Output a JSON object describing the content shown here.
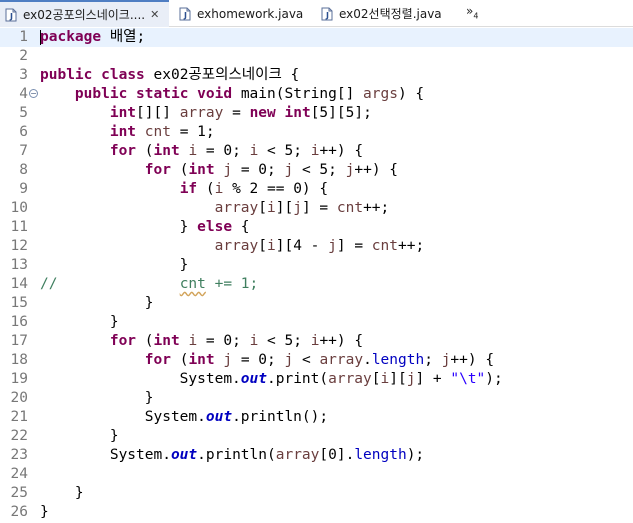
{
  "tabs": [
    {
      "label": "ex02공포의스네이크....",
      "active": true,
      "closable": true,
      "icon": "java-file-icon"
    },
    {
      "label": "exhomework.java",
      "active": false,
      "closable": false,
      "icon": "java-file-icon"
    },
    {
      "label": "ex02선택정렬.java",
      "active": false,
      "closable": false,
      "icon": "java-file-icon"
    }
  ],
  "overflow": {
    "glyph": "»",
    "count": "4"
  },
  "editor": {
    "current_line": 1,
    "lines": [
      {
        "n": "1",
        "tokens": [
          [
            "kw",
            "package"
          ],
          [
            "t",
            " 배열;"
          ]
        ]
      },
      {
        "n": "2",
        "tokens": []
      },
      {
        "n": "3",
        "tokens": [
          [
            "kw",
            "public"
          ],
          [
            "t",
            " "
          ],
          [
            "kw",
            "class"
          ],
          [
            "t",
            " ex02공포의스네이크 {"
          ]
        ]
      },
      {
        "n": "4",
        "fold": "⊖",
        "tokens": [
          [
            "t",
            "    "
          ],
          [
            "kw",
            "public"
          ],
          [
            "t",
            " "
          ],
          [
            "kw",
            "static"
          ],
          [
            "t",
            " "
          ],
          [
            "kw",
            "void"
          ],
          [
            "t",
            " main(String[] "
          ],
          [
            "var",
            "args"
          ],
          [
            "t",
            ") {"
          ]
        ]
      },
      {
        "n": "5",
        "tokens": [
          [
            "t",
            "        "
          ],
          [
            "kw",
            "int"
          ],
          [
            "t",
            "[][] "
          ],
          [
            "var",
            "array"
          ],
          [
            "t",
            " = "
          ],
          [
            "kw",
            "new"
          ],
          [
            "t",
            " "
          ],
          [
            "kw",
            "int"
          ],
          [
            "t",
            "[5][5];"
          ]
        ]
      },
      {
        "n": "6",
        "tokens": [
          [
            "t",
            "        "
          ],
          [
            "kw",
            "int"
          ],
          [
            "t",
            " "
          ],
          [
            "var",
            "cnt"
          ],
          [
            "t",
            " = 1;"
          ]
        ]
      },
      {
        "n": "7",
        "tokens": [
          [
            "t",
            "        "
          ],
          [
            "kw",
            "for"
          ],
          [
            "t",
            " ("
          ],
          [
            "kw",
            "int"
          ],
          [
            "t",
            " "
          ],
          [
            "var",
            "i"
          ],
          [
            "t",
            " = 0; "
          ],
          [
            "var",
            "i"
          ],
          [
            "t",
            " < 5; "
          ],
          [
            "var",
            "i"
          ],
          [
            "t",
            "++) {"
          ]
        ]
      },
      {
        "n": "8",
        "tokens": [
          [
            "t",
            "            "
          ],
          [
            "kw",
            "for"
          ],
          [
            "t",
            " ("
          ],
          [
            "kw",
            "int"
          ],
          [
            "t",
            " "
          ],
          [
            "var",
            "j"
          ],
          [
            "t",
            " = 0; "
          ],
          [
            "var",
            "j"
          ],
          [
            "t",
            " < 5; "
          ],
          [
            "var",
            "j"
          ],
          [
            "t",
            "++) {"
          ]
        ]
      },
      {
        "n": "9",
        "tokens": [
          [
            "t",
            "                "
          ],
          [
            "kw",
            "if"
          ],
          [
            "t",
            " ("
          ],
          [
            "var",
            "i"
          ],
          [
            "t",
            " % 2 == 0) {"
          ]
        ]
      },
      {
        "n": "10",
        "tokens": [
          [
            "t",
            "                    "
          ],
          [
            "var",
            "array"
          ],
          [
            "t",
            "["
          ],
          [
            "var",
            "i"
          ],
          [
            "t",
            "]["
          ],
          [
            "var",
            "j"
          ],
          [
            "t",
            "] = "
          ],
          [
            "var",
            "cnt"
          ],
          [
            "t",
            "++;"
          ]
        ]
      },
      {
        "n": "11",
        "tokens": [
          [
            "t",
            "                } "
          ],
          [
            "kw",
            "else"
          ],
          [
            "t",
            " {"
          ]
        ]
      },
      {
        "n": "12",
        "tokens": [
          [
            "t",
            "                    "
          ],
          [
            "var",
            "array"
          ],
          [
            "t",
            "["
          ],
          [
            "var",
            "i"
          ],
          [
            "t",
            "][4 - "
          ],
          [
            "var",
            "j"
          ],
          [
            "t",
            "] = "
          ],
          [
            "var",
            "cnt"
          ],
          [
            "t",
            "++;"
          ]
        ]
      },
      {
        "n": "13",
        "tokens": [
          [
            "t",
            "                }"
          ]
        ]
      },
      {
        "n": "14",
        "tokens": [
          [
            "cmt",
            "//              "
          ],
          [
            "cmtw",
            "cnt"
          ],
          [
            "cmt",
            " += 1;"
          ]
        ]
      },
      {
        "n": "15",
        "tokens": [
          [
            "t",
            "            }"
          ]
        ]
      },
      {
        "n": "16",
        "tokens": [
          [
            "t",
            "        }"
          ]
        ]
      },
      {
        "n": "17",
        "tokens": [
          [
            "t",
            "        "
          ],
          [
            "kw",
            "for"
          ],
          [
            "t",
            " ("
          ],
          [
            "kw",
            "int"
          ],
          [
            "t",
            " "
          ],
          [
            "var",
            "i"
          ],
          [
            "t",
            " = 0; "
          ],
          [
            "var",
            "i"
          ],
          [
            "t",
            " < 5; "
          ],
          [
            "var",
            "i"
          ],
          [
            "t",
            "++) {"
          ]
        ]
      },
      {
        "n": "18",
        "tokens": [
          [
            "t",
            "            "
          ],
          [
            "kw",
            "for"
          ],
          [
            "t",
            " ("
          ],
          [
            "kw",
            "int"
          ],
          [
            "t",
            " "
          ],
          [
            "var",
            "j"
          ],
          [
            "t",
            " = 0; "
          ],
          [
            "var",
            "j"
          ],
          [
            "t",
            " < "
          ],
          [
            "var",
            "array"
          ],
          [
            "t",
            "."
          ],
          [
            "fld",
            "length"
          ],
          [
            "t",
            "; "
          ],
          [
            "var",
            "j"
          ],
          [
            "t",
            "++) {"
          ]
        ]
      },
      {
        "n": "19",
        "tokens": [
          [
            "t",
            "                System."
          ],
          [
            "sfld",
            "out"
          ],
          [
            "t",
            ".print("
          ],
          [
            "var",
            "array"
          ],
          [
            "t",
            "["
          ],
          [
            "var",
            "i"
          ],
          [
            "t",
            "]["
          ],
          [
            "var",
            "j"
          ],
          [
            "t",
            "] + "
          ],
          [
            "str",
            "\"\\t\""
          ],
          [
            "t",
            ");"
          ]
        ]
      },
      {
        "n": "20",
        "tokens": [
          [
            "t",
            "            }"
          ]
        ]
      },
      {
        "n": "21",
        "tokens": [
          [
            "t",
            "            System."
          ],
          [
            "sfld",
            "out"
          ],
          [
            "t",
            ".println();"
          ]
        ]
      },
      {
        "n": "22",
        "tokens": [
          [
            "t",
            "        }"
          ]
        ]
      },
      {
        "n": "23",
        "tokens": [
          [
            "t",
            "        System."
          ],
          [
            "sfld",
            "out"
          ],
          [
            "t",
            ".println("
          ],
          [
            "var",
            "array"
          ],
          [
            "t",
            "[0]."
          ],
          [
            "fld",
            "length"
          ],
          [
            "t",
            ");"
          ]
        ]
      },
      {
        "n": "24",
        "tokens": []
      },
      {
        "n": "25",
        "tokens": [
          [
            "t",
            "    }"
          ]
        ]
      },
      {
        "n": "26",
        "tokens": [
          [
            "t",
            "}"
          ]
        ]
      }
    ]
  },
  "colors": {
    "keyword": "#7f0055",
    "local_variable": "#6a3e3e",
    "field": "#0000c0",
    "string": "#2a00ff",
    "comment": "#3f7f5f",
    "current_line_bg": "#e8f2fe",
    "active_tab_accent": "#4f7ec3"
  }
}
